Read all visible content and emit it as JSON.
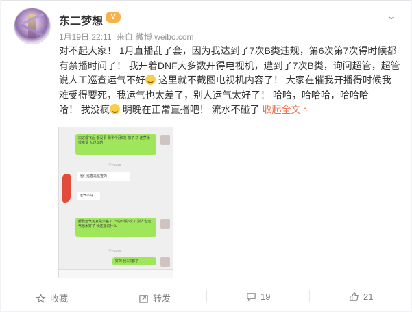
{
  "post": {
    "username": "东二梦想",
    "vip_badge": "V",
    "date": "1月19日 22:11",
    "source_prefix": "来自",
    "source": "微博 weibo.com",
    "lines": [
      "对不起大家！ 1月直播乱了套，因为我达到了7次B类违规，第6次第7次得时候都",
      "有禁播时间了！ 我开着DNF大多数开得电视机，遭到了7次B类，询问超管，超管",
      "说人工巡查运气不好",
      " 这里就不截图电视机内容了！  大家在催我开播得时候我",
      "难受得要死，我运气也太差了，别人运气太好了！  哈哈，哈哈哈，哈哈哈",
      "哈！  我没疯",
      " 明晚在正常直播吧！ 流水不碰了 ",
      "收起全文"
    ],
    "collapse_chevron": "^"
  },
  "screenshot": {
    "bubble1": "口述都飞起 都没事 我半个月6次 扣了   块 还禁播 很难受 大过年的",
    "time1": "下午12:58",
    "bubble2": "他们巡查是巡查的",
    "bubble3": "运气不好",
    "bubble4": "都我运气可真是太差了 15的时候5次了  别人也运气也太好了 我还能说什么",
    "time2": "下午12:59",
    "bubble5": "好的  我7次都了"
  },
  "actions": {
    "favorite": "收藏",
    "repost": "转发",
    "comment_count": "19",
    "like_count": "21"
  }
}
